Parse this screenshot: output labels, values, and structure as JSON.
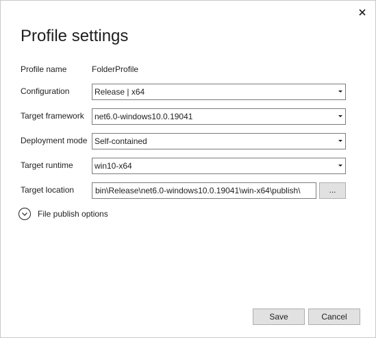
{
  "dialog": {
    "title": "Profile settings",
    "close_icon": "close-icon"
  },
  "fields": {
    "profile_name": {
      "label": "Profile name",
      "value": "FolderProfile"
    },
    "configuration": {
      "label": "Configuration",
      "value": "Release | x64"
    },
    "target_framework": {
      "label": "Target framework",
      "value": "net6.0-windows10.0.19041"
    },
    "deployment_mode": {
      "label": "Deployment mode",
      "value": "Self-contained"
    },
    "target_runtime": {
      "label": "Target runtime",
      "value": "win10-x64"
    },
    "target_location": {
      "label": "Target location",
      "value": "bin\\Release\\net6.0-windows10.0.19041\\win-x64\\publish\\",
      "browse_label": "..."
    }
  },
  "expander": {
    "label": "File publish options",
    "icon": "chevron-down-circle-icon"
  },
  "buttons": {
    "save": "Save",
    "cancel": "Cancel"
  }
}
